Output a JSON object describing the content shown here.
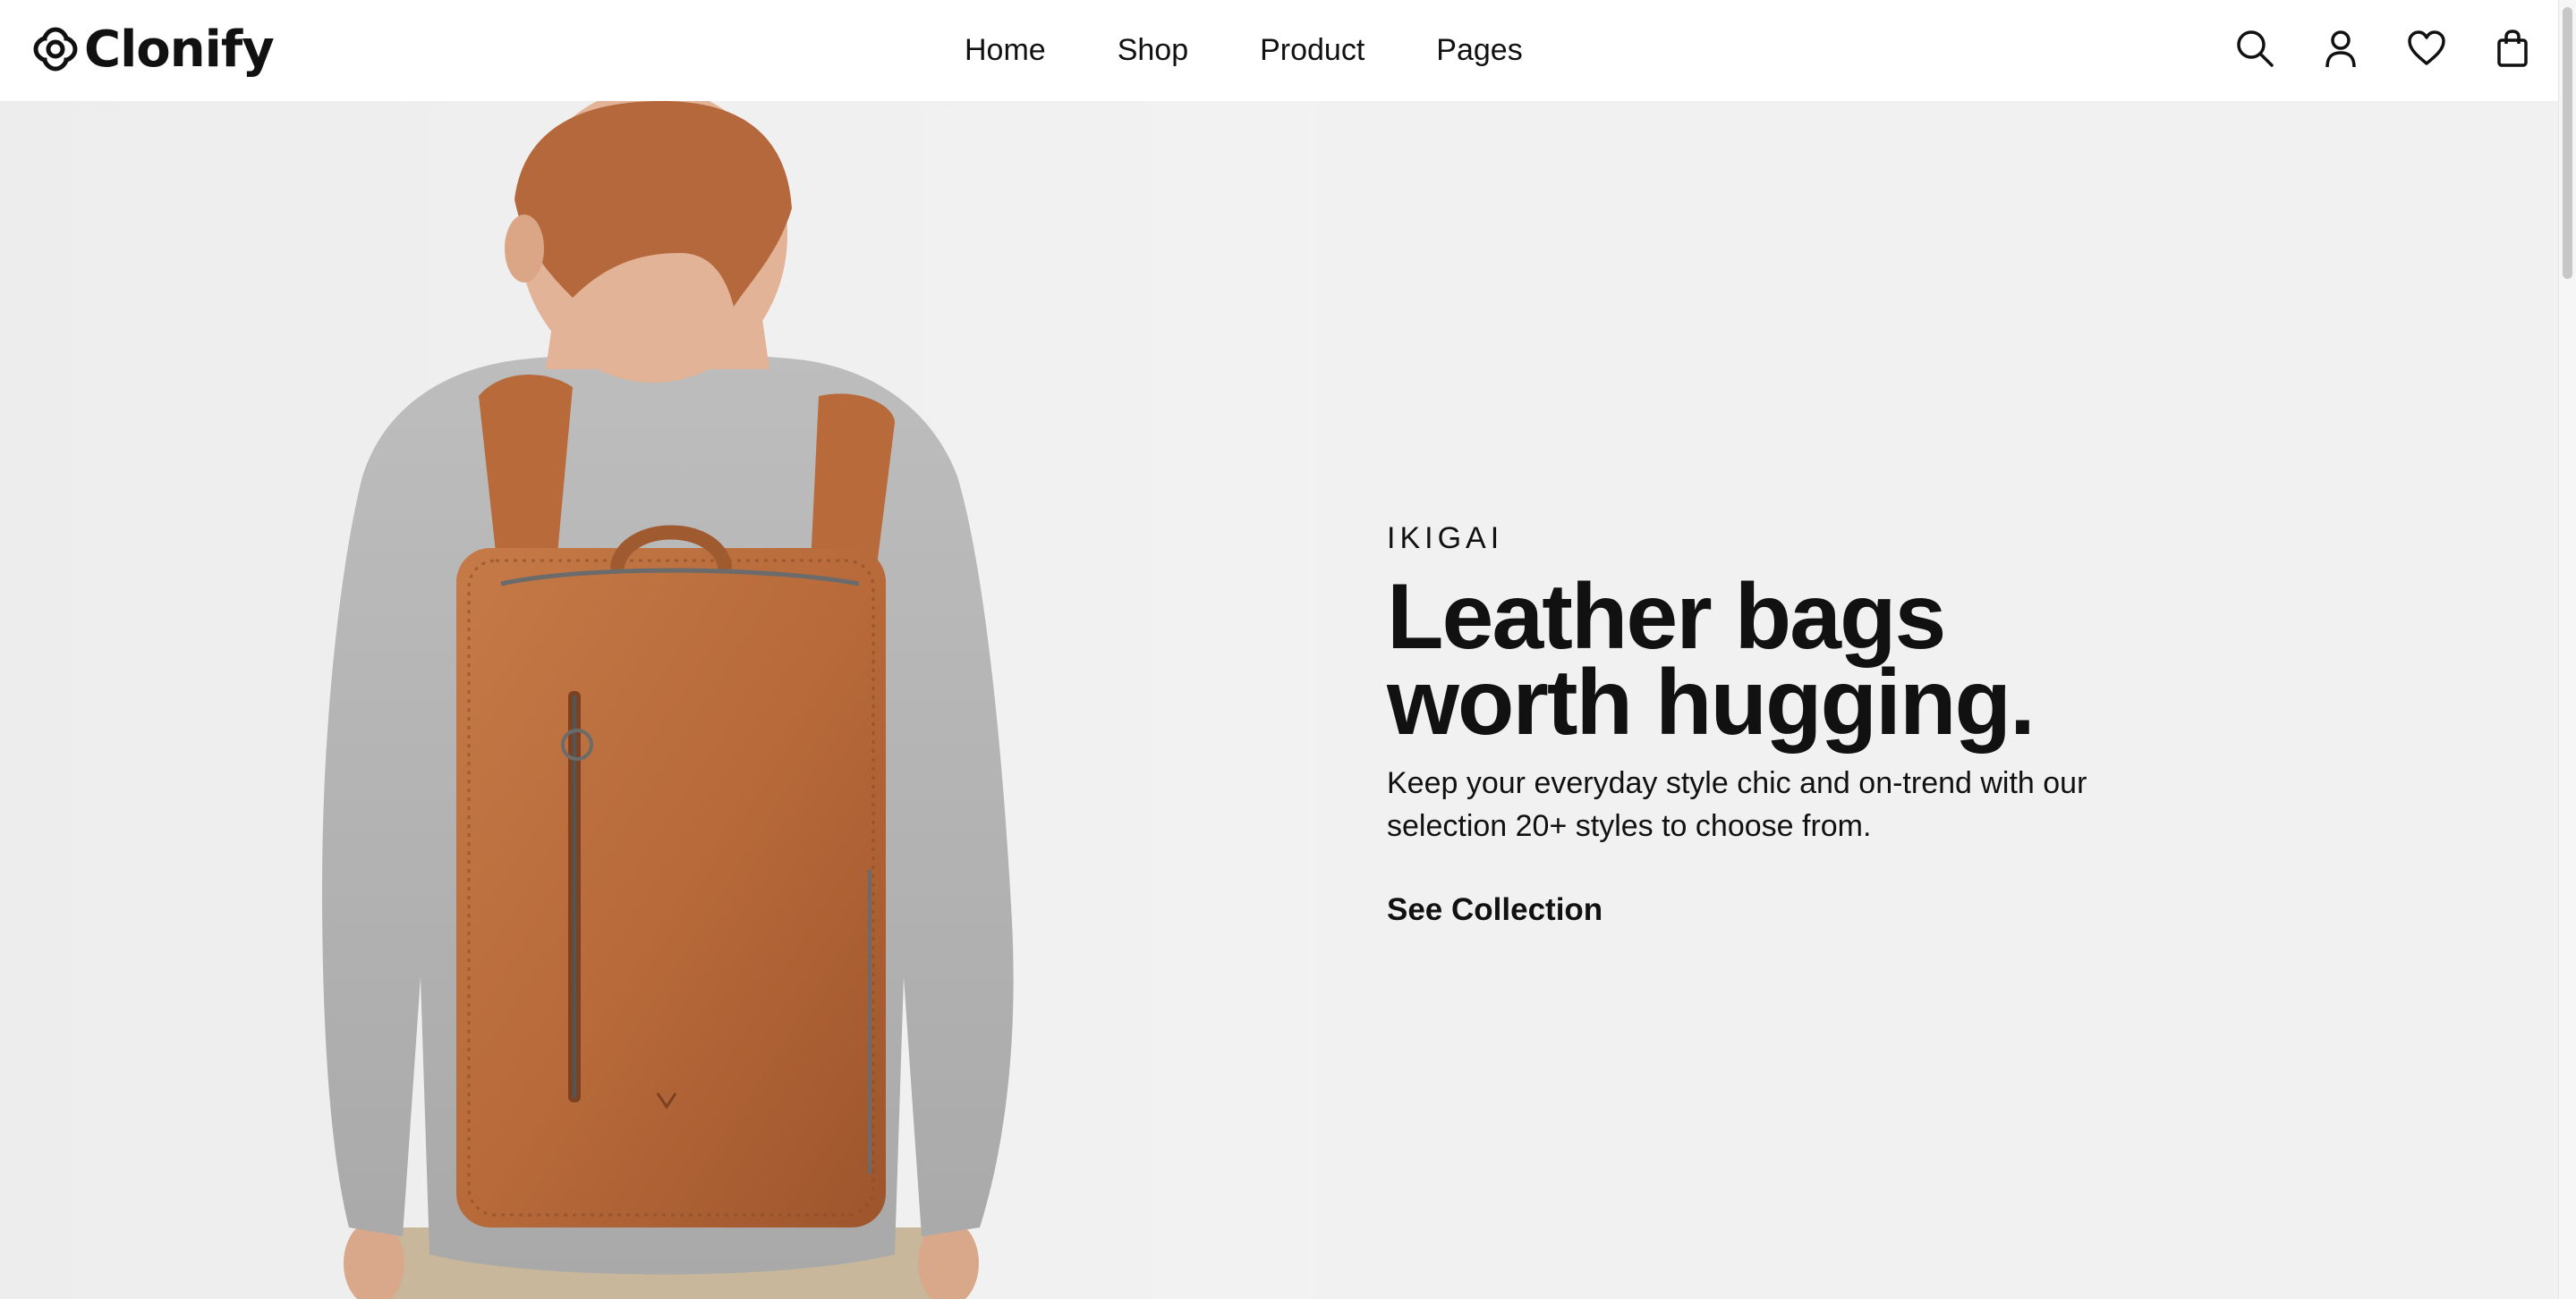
{
  "header": {
    "logo_text": "Clonify",
    "nav": [
      "Home",
      "Shop",
      "Product",
      "Pages"
    ],
    "actions": [
      {
        "name": "search-icon"
      },
      {
        "name": "user-icon"
      },
      {
        "name": "heart-icon"
      },
      {
        "name": "shopping-bag-icon"
      }
    ]
  },
  "hero": {
    "eyebrow": "IKIGAI",
    "headline_line1": "Leather bags",
    "headline_line2": "worth hugging.",
    "subtext": "Keep your everyday style chic and on-trend with our selection 20+ styles to choose from.",
    "cta": "See Collection",
    "image_alt": "product-photo-leather-backpack"
  },
  "colors": {
    "background": "#ffffff",
    "hero_bg": "#f1f1f1",
    "text": "#111111",
    "backpack": "#b86a3a"
  }
}
